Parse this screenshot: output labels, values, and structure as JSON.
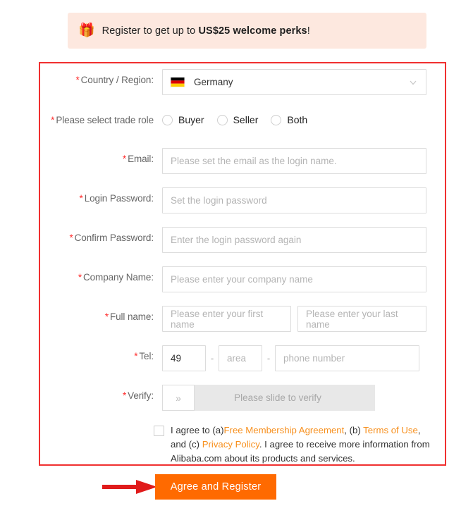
{
  "banner": {
    "icon": "gift-box-icon",
    "text_before": "Register to get up to ",
    "highlight": "US$25 welcome perks",
    "text_after": "!",
    "background_color": "#FDE8DF"
  },
  "form": {
    "country": {
      "label": "Country / Region:",
      "required_mark": "*",
      "value": "Germany",
      "flag": "germany-flag",
      "chevron": "chevron-down-icon"
    },
    "trade_role": {
      "label": "Please select trade role",
      "required_mark": "*",
      "options": [
        {
          "label": "Buyer",
          "selected": false
        },
        {
          "label": "Seller",
          "selected": false
        },
        {
          "label": "Both",
          "selected": false
        }
      ]
    },
    "email": {
      "label": "Email:",
      "required_mark": "*",
      "placeholder": "Please set the email as the login name.",
      "value": ""
    },
    "login_password": {
      "label": "Login Password:",
      "required_mark": "*",
      "placeholder": "Set the login password",
      "value": ""
    },
    "confirm_password": {
      "label": "Confirm Password:",
      "required_mark": "*",
      "placeholder": "Enter the login password again",
      "value": ""
    },
    "company_name": {
      "label": "Company Name:",
      "required_mark": "*",
      "placeholder": "Please enter your company name",
      "value": ""
    },
    "full_name": {
      "label": "Full name:",
      "required_mark": "*",
      "first_placeholder": "Please enter your first name",
      "last_placeholder": "Please enter your last name",
      "first_value": "",
      "last_value": ""
    },
    "tel": {
      "label": "Tel:",
      "required_mark": "*",
      "country_code": "49",
      "area_placeholder": "area",
      "phone_placeholder": "phone number",
      "separator": "-"
    },
    "verify": {
      "label": "Verify:",
      "required_mark": "*",
      "handle_icon": "double-chevron-right-icon",
      "text": "Please slide to verify"
    },
    "agreement": {
      "checked": false,
      "part1": "I agree to (a)",
      "link1": "Free Membership Agreement",
      "part2": ", (b) ",
      "link2": "Terms of Use",
      "part3": ", and (c) ",
      "link3": "Privacy Policy",
      "part4": ". I agree to receive more information from Alibaba.com about its products and services."
    },
    "submit_label": "Agree and Register",
    "submit_color": "#FF6A00",
    "annotation_color": "#F03030"
  }
}
